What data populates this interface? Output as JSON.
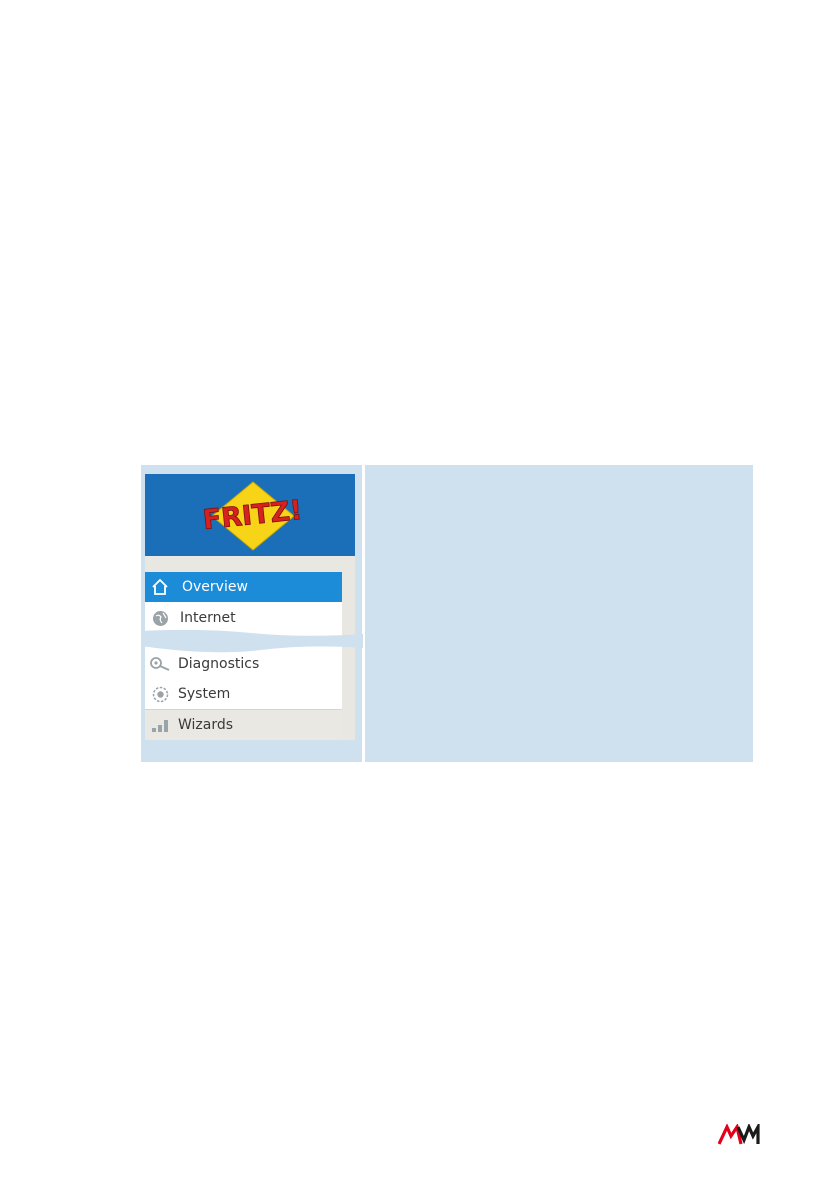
{
  "header": {
    "logo_text": "FRITZ!",
    "brand_color": "#1a6fb8"
  },
  "menu": {
    "items": [
      {
        "label": "Overview",
        "icon": "home-icon",
        "state": "active"
      },
      {
        "label": "Internet",
        "icon": "globe-icon"
      },
      {
        "label": "Diagnostics",
        "icon": "magnifier-icon"
      },
      {
        "label": "System",
        "icon": "gear-icon"
      },
      {
        "label": "Wizards",
        "icon": "signal-bars-icon"
      }
    ],
    "active_color": "#1c8cd9"
  },
  "footer": {
    "logo_text": "AVM",
    "logo_color": "#e2001a"
  }
}
